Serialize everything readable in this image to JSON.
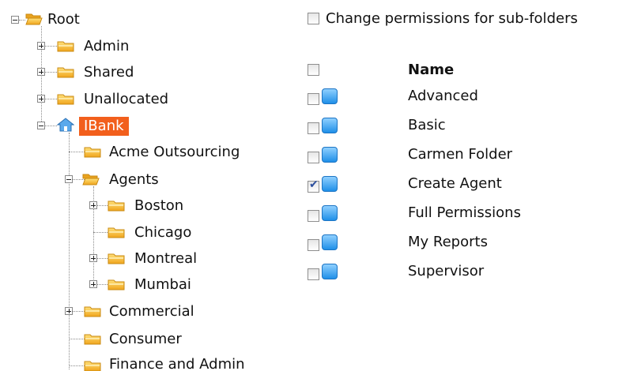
{
  "tree": {
    "root": "Root",
    "admin": "Admin",
    "shared": "Shared",
    "unallocated": "Unallocated",
    "ibank": "IBank",
    "acme": "Acme Outsourcing",
    "agents": "Agents",
    "boston": "Boston",
    "chicago": "Chicago",
    "montreal": "Montreal",
    "mumbai": "Mumbai",
    "commercial": "Commercial",
    "consumer": "Consumer",
    "finance": "Finance and Admin"
  },
  "options": {
    "subfolders_label": "Change permissions for sub-folders"
  },
  "permissions": {
    "header": "Name",
    "items": [
      {
        "label": "Advanced",
        "checked": false
      },
      {
        "label": "Basic",
        "checked": false
      },
      {
        "label": "Carmen Folder",
        "checked": false
      },
      {
        "label": "Create Agent",
        "checked": true
      },
      {
        "label": "Full Permissions",
        "checked": false
      },
      {
        "label": "My Reports",
        "checked": false
      },
      {
        "label": "Supervisor",
        "checked": false
      }
    ]
  },
  "colors": {
    "selection": "#f25f1c",
    "folder": "#f5b52e",
    "perm_icon": "#1f8fe8"
  }
}
